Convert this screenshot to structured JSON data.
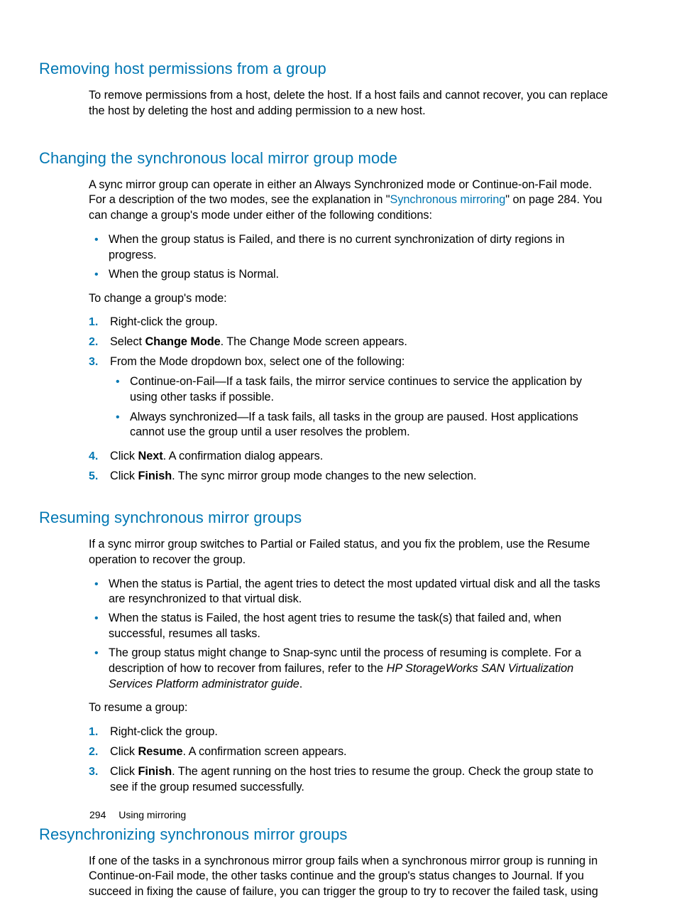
{
  "section1": {
    "heading": "Removing host permissions from a group",
    "para": "To remove permissions from a host, delete the host. If a host fails and cannot recover, you can replace the host by deleting the host and adding permission to a new host."
  },
  "section2": {
    "heading": "Changing the synchronous local mirror group mode",
    "intro_a": "A sync mirror group can operate in either an Always Synchronized mode or Continue-on-Fail mode. For a description of the two modes, see the explanation in \"",
    "intro_link": "Synchronous mirroring",
    "intro_b": "\" on page 284. You can change a group's mode under either of the following conditions:",
    "conds": [
      "When the group status is Failed, and there is no current synchronization of dirty regions in progress.",
      "When the group status is Normal."
    ],
    "lead": "To change a group's mode:",
    "steps": {
      "s1": "Right-click the group.",
      "s2_a": "Select ",
      "s2_bold": "Change Mode",
      "s2_b": ". The Change Mode screen appears.",
      "s3": "From the Mode dropdown box, select one of the following:",
      "s3_opts": [
        "Continue-on-Fail—If a task fails, the mirror service continues to service the application by using other tasks if possible.",
        "Always synchronized—If a task fails, all tasks in the group are paused. Host applications cannot use the group until a user resolves the problem."
      ],
      "s4_a": "Click ",
      "s4_bold": "Next",
      "s4_b": ". A confirmation dialog appears.",
      "s5_a": "Click ",
      "s5_bold": "Finish",
      "s5_b": ". The sync mirror group mode changes to the new selection."
    }
  },
  "section3": {
    "heading": "Resuming synchronous mirror groups",
    "intro": "If a sync mirror group switches to Partial or Failed status, and you fix the problem, use the Resume operation to recover the group.",
    "bullets": {
      "b1": "When the status is Partial, the agent tries to detect the most updated virtual disk and all the tasks are resynchronized to that virtual disk.",
      "b2": "When the status is Failed, the host agent tries to resume the task(s) that failed and, when successful, resumes all tasks.",
      "b3_a": "The group status might change to Snap-sync until the process of resuming is complete. For a description of how to recover from failures, refer to the ",
      "b3_italic": "HP StorageWorks SAN Virtualization Services Platform administrator guide",
      "b3_b": "."
    },
    "lead": "To resume a group:",
    "steps": {
      "s1": "Right-click the group.",
      "s2_a": "Click ",
      "s2_bold": "Resume",
      "s2_b": ". A confirmation screen appears.",
      "s3_a": "Click ",
      "s3_bold": "Finish",
      "s3_b": ". The agent running on the host tries to resume the group. Check the group state to see if the group resumed successfully."
    }
  },
  "section4": {
    "heading": "Resynchronizing synchronous mirror groups",
    "para": "If one of the tasks in a synchronous mirror group fails when a synchronous mirror group is running in Continue-on-Fail mode, the other tasks continue and the group's status changes to Journal. If you succeed in fixing the cause of failure, you can trigger the group to try to recover the failed task, using"
  },
  "footer": {
    "page": "294",
    "title": "Using mirroring"
  }
}
